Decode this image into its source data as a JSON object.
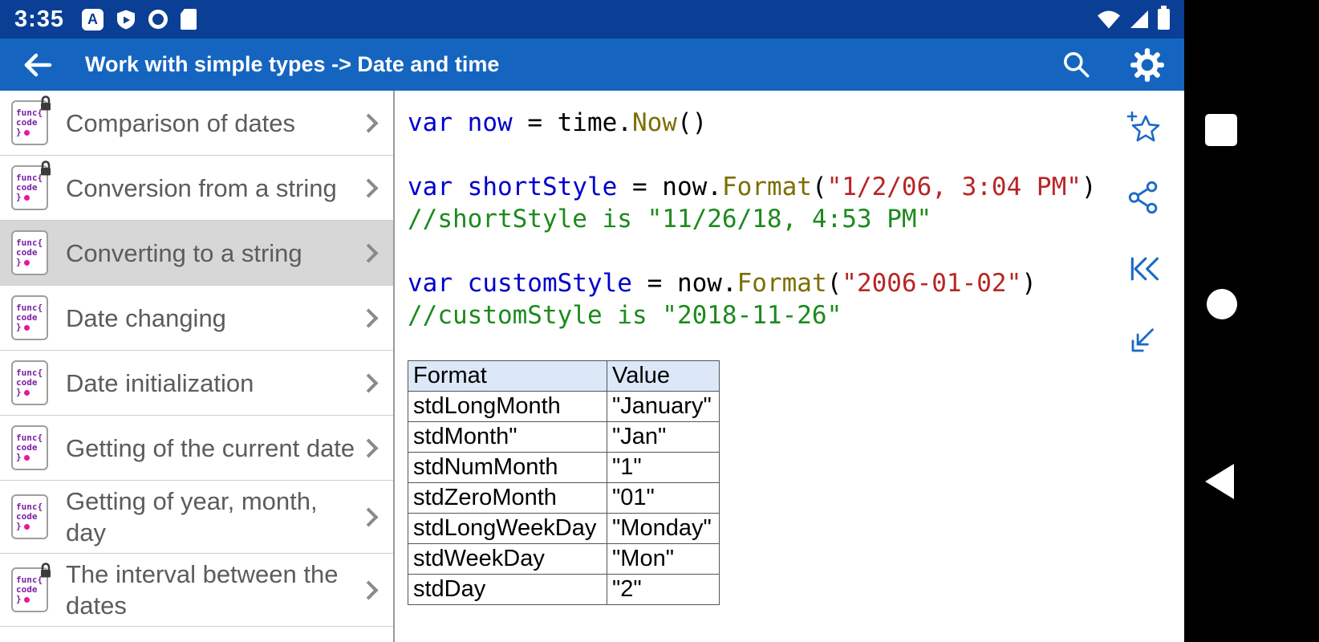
{
  "status_bar": {
    "time": "3:35",
    "left_icons": [
      "translate-icon",
      "play-protect-icon",
      "ring-app-icon",
      "sim-card-icon"
    ],
    "right_icons": [
      "wifi-icon",
      "cell-signal-icon",
      "battery-icon"
    ]
  },
  "app_bar": {
    "title": "Work with simple types -> Date and time"
  },
  "sidebar": {
    "icon_text": [
      "func{",
      "code",
      "}"
    ],
    "items": [
      {
        "label": "Comparison of dates",
        "locked": true,
        "selected": false
      },
      {
        "label": "Conversion from a string",
        "locked": true,
        "selected": false
      },
      {
        "label": "Converting to a string",
        "locked": false,
        "selected": true
      },
      {
        "label": "Date changing",
        "locked": false,
        "selected": false
      },
      {
        "label": "Date initialization",
        "locked": false,
        "selected": false
      },
      {
        "label": "Getting of the current date",
        "locked": false,
        "selected": false
      },
      {
        "label": "Getting of year, month, day",
        "locked": false,
        "selected": false
      },
      {
        "label": "The interval between the dates",
        "locked": true,
        "selected": false
      }
    ]
  },
  "code": {
    "lines": [
      [
        {
          "t": "var now",
          "c": "blue"
        },
        {
          "t": " = time.",
          "c": "plain"
        },
        {
          "t": "Now",
          "c": "olive"
        },
        {
          "t": "()",
          "c": "plain"
        }
      ],
      [],
      [
        {
          "t": "var shortStyle",
          "c": "blue"
        },
        {
          "t": " = now.",
          "c": "plain"
        },
        {
          "t": "Format",
          "c": "olive"
        },
        {
          "t": "(",
          "c": "plain"
        },
        {
          "t": "\"1/2/06, 3:04 PM\"",
          "c": "red"
        },
        {
          "t": ")",
          "c": "plain"
        }
      ],
      [
        {
          "t": "//shortStyle is \"11/26/18, 4:53 PM\"",
          "c": "green"
        }
      ],
      [],
      [
        {
          "t": "var customStyle",
          "c": "blue"
        },
        {
          "t": " = now.",
          "c": "plain"
        },
        {
          "t": "Format",
          "c": "olive"
        },
        {
          "t": "(",
          "c": "plain"
        },
        {
          "t": "\"2006-01-02\"",
          "c": "red"
        },
        {
          "t": ")",
          "c": "plain"
        }
      ],
      [
        {
          "t": "//customStyle is \"2018-11-26\"",
          "c": "green"
        }
      ]
    ]
  },
  "format_table": {
    "headers": [
      "Format",
      "Value"
    ],
    "rows": [
      [
        "stdLongMonth",
        "\"January\""
      ],
      [
        "stdMonth\"",
        "\"Jan\""
      ],
      [
        "stdNumMonth",
        "\"1\""
      ],
      [
        "stdZeroMonth",
        "\"01\""
      ],
      [
        "stdLongWeekDay",
        "\"Monday\""
      ],
      [
        "stdWeekDay",
        "\"Mon\""
      ],
      [
        "stdDay",
        "\"2\""
      ]
    ]
  },
  "colors": {
    "status_bar": "#0a3f95",
    "app_bar": "#1565c0",
    "action_icon_blue": "#1b6ac6",
    "code_blue": "#0000cd",
    "code_olive": "#7d6e00",
    "code_red": "#b82525",
    "code_green": "#1d8a1d",
    "table_header_bg": "#dce8f8",
    "selected_item_bg": "#d7d7d7"
  }
}
